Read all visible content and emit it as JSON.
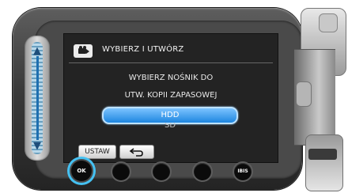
{
  "screen": {
    "title": "WYBIERZ I UTWÓRZ",
    "message_line1": "WYBIERZ NOŚNIK DO",
    "message_line2": "UTW. KOPII ZAPASOWEJ",
    "options": [
      {
        "label": "HDD",
        "selected": true
      },
      {
        "label": "SD",
        "selected": false
      }
    ],
    "set_button_label": "USTAW"
  },
  "hardware_buttons": [
    {
      "label": "OK",
      "highlighted": true
    },
    {
      "label": ""
    },
    {
      "label": ""
    },
    {
      "label": ""
    },
    {
      "label": "IBIS"
    }
  ],
  "colors": {
    "highlight": "#45c1f2",
    "selected_option": "#1e86e0"
  },
  "icons": [
    "movie-camera-icon",
    "back-arrow-icon",
    "slider-up-arrow-icon",
    "slider-down-arrow-icon"
  ]
}
